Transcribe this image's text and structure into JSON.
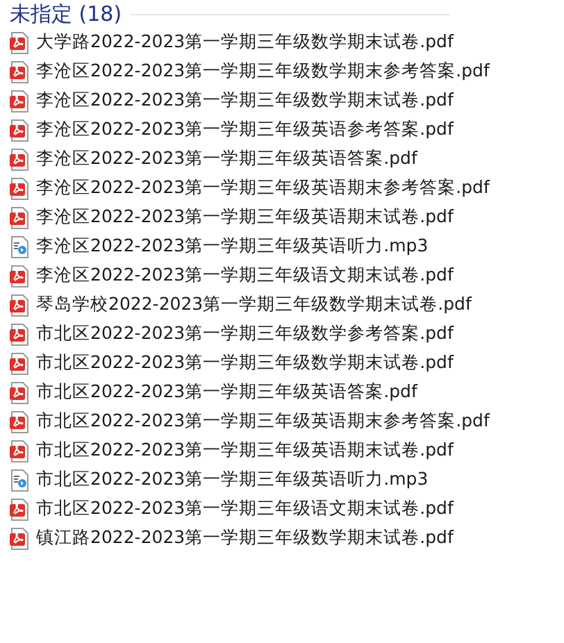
{
  "group": {
    "title": "未指定 (18)"
  },
  "files": [
    {
      "name": "大学路2022-2023第一学期三年级数学期末试卷.pdf",
      "kind": "pdf"
    },
    {
      "name": "李沧区2022-2023第一学期三年级数学期末参考答案.pdf",
      "kind": "pdf"
    },
    {
      "name": "李沧区2022-2023第一学期三年级数学期末试卷.pdf",
      "kind": "pdf"
    },
    {
      "name": "李沧区2022-2023第一学期三年级英语参考答案.pdf",
      "kind": "pdf"
    },
    {
      "name": "李沧区2022-2023第一学期三年级英语答案.pdf",
      "kind": "pdf"
    },
    {
      "name": "李沧区2022-2023第一学期三年级英语期末参考答案.pdf",
      "kind": "pdf"
    },
    {
      "name": "李沧区2022-2023第一学期三年级英语期末试卷.pdf",
      "kind": "pdf"
    },
    {
      "name": "李沧区2022-2023第一学期三年级英语听力.mp3",
      "kind": "mp3"
    },
    {
      "name": "李沧区2022-2023第一学期三年级语文期末试卷.pdf",
      "kind": "pdf"
    },
    {
      "name": "琴岛学校2022-2023第一学期三年级数学期末试卷.pdf",
      "kind": "pdf"
    },
    {
      "name": "市北区2022-2023第一学期三年级数学参考答案.pdf",
      "kind": "pdf"
    },
    {
      "name": "市北区2022-2023第一学期三年级数学期末试卷.pdf",
      "kind": "pdf"
    },
    {
      "name": "市北区2022-2023第一学期三年级英语答案.pdf",
      "kind": "pdf"
    },
    {
      "name": "市北区2022-2023第一学期三年级英语期末参考答案.pdf",
      "kind": "pdf"
    },
    {
      "name": "市北区2022-2023第一学期三年级英语期末试卷.pdf",
      "kind": "pdf"
    },
    {
      "name": "市北区2022-2023第一学期三年级英语听力.mp3",
      "kind": "mp3"
    },
    {
      "name": "市北区2022-2023第一学期三年级语文期末试卷.pdf",
      "kind": "pdf"
    },
    {
      "name": "镇江路2022-2023第一学期三年级数学期末试卷.pdf",
      "kind": "pdf"
    }
  ]
}
